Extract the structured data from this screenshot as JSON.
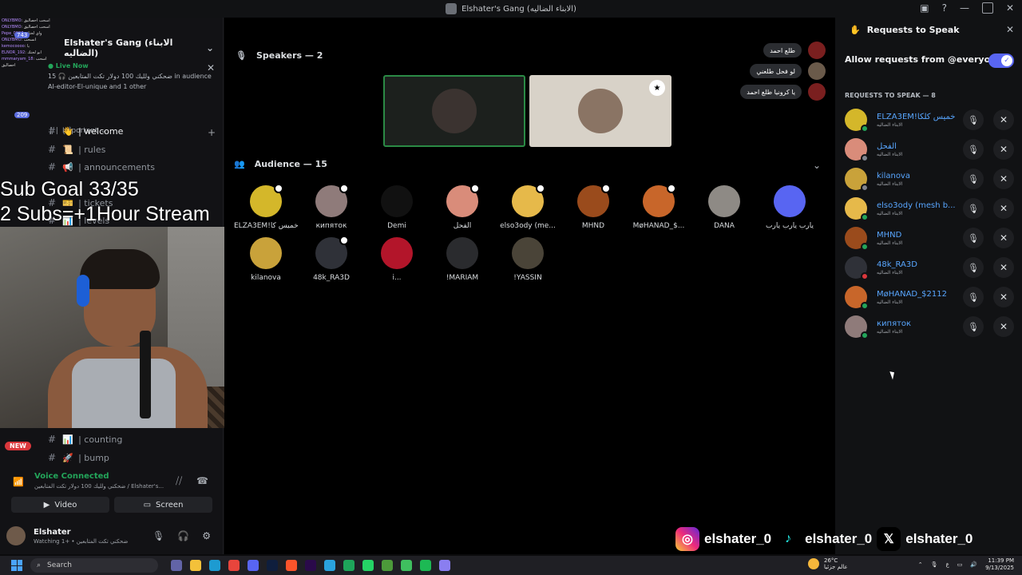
{
  "window": {
    "title": "Elshater's Gang (الابناء الضاليه)"
  },
  "sidebar": {
    "server_name": "Elshater's Gang (الابناء الضاليه)",
    "live": {
      "label": "Live Now",
      "line1": "ضحكني ولليك 100 دولار تكت المتابعين",
      "audience": "15 in audience",
      "line2": "AI-editor-El-unique and 1 other"
    },
    "overlay_chat": [
      {
        "nick": "ONLYBMO",
        "msg": "اسحب احصاليق"
      },
      {
        "nick": "ONLYBMO",
        "msg": "اسحب احصاليق"
      },
      {
        "nick": "Pepe_0997",
        "msg": "واي لحتك"
      },
      {
        "nick": "ONLYBMO",
        "msg": "انسحب"
      },
      {
        "nick": "kemocoooo",
        "msg": "يا"
      },
      {
        "nick": "ELNOR_192",
        "msg": "ابو لحتك"
      },
      {
        "nick": "mmmaryam_18",
        "msg": "اسحب احصاليق"
      }
    ],
    "badges": [
      "743",
      "209"
    ],
    "category": "Important",
    "channels": [
      {
        "emoji": "👋",
        "label": "| welcome",
        "active": true
      },
      {
        "emoji": "📜",
        "label": "| rules",
        "active": false
      },
      {
        "emoji": "📢",
        "label": "| announcements",
        "active": false
      },
      {
        "emoji": "🎫",
        "label": "| tickets",
        "active": false
      },
      {
        "emoji": "📊",
        "label": "| levels",
        "active": false
      }
    ],
    "bottom_channels": [
      {
        "emoji": "📊",
        "label": "| counting"
      },
      {
        "emoji": "🚀",
        "label": "| bump"
      }
    ],
    "new_label": "NEW",
    "voice": {
      "status": "Voice Connected",
      "detail": "ضحكني ولليك 100 دولار تكت المتابعين / Elshater's..."
    },
    "video_label": "Video",
    "screen_label": "Screen",
    "user": {
      "name": "Elshater",
      "status": "Watching ضحكني تكت المتابعين • +1"
    }
  },
  "overlay": {
    "goal_line1": "Sub Goal 33/35",
    "goal_line2": "2 Subs=+1Hour Stream"
  },
  "stage": {
    "speakers_label": "Speakers — 2",
    "audience_label": "Audience — 15",
    "chat": [
      {
        "text": "طلع احمد"
      },
      {
        "text": "لو فحل طلعني"
      },
      {
        "text": "يا كرونيا طلع احمد"
      }
    ],
    "audience": [
      {
        "name": "ELZA3EM!خميس كا",
        "color": "#d4b72a",
        "mod": true
      },
      {
        "name": "кипяток",
        "color": "#8f7b7a",
        "mod": true
      },
      {
        "name": "Demi",
        "color": "#111111",
        "mod": false
      },
      {
        "name": "الفحل",
        "color": "#d98c7a",
        "mod": true
      },
      {
        "name": "elso3ody (me...",
        "color": "#e6b94a",
        "mod": true
      },
      {
        "name": "MHND",
        "color": "#9a4b1c",
        "mod": true
      },
      {
        "name": "MøHANAD_$...",
        "color": "#c8662a",
        "mod": true
      },
      {
        "name": "DANA",
        "color": "#8e8a85",
        "mod": false
      },
      {
        "name": "يارب يارب يارب",
        "color": "#5865f2",
        "mod": false
      },
      {
        "name": "kilanova",
        "color": "#c9a23a",
        "mod": false
      },
      {
        "name": "48k_RA3D",
        "color": "#2f3138",
        "mod": true
      },
      {
        "name": "i...",
        "color": "#b3152a",
        "mod": false
      },
      {
        "name": "!MARIAM",
        "color": "#2a2b2e",
        "mod": false
      },
      {
        "name": "!YASSIN",
        "color": "#4a4438",
        "mod": false
      }
    ]
  },
  "requests": {
    "title": "Requests to Speak",
    "allow_label": "Allow requests from @everyone",
    "allow_enabled": true,
    "count_label": "REQUESTS TO SPEAK — 8",
    "items": [
      {
        "name": "ELZA3EM!خميس كلكا",
        "sub": "الابناء الضاليه",
        "color": "#d4b72a",
        "status": "#23a55a"
      },
      {
        "name": "الفحل",
        "sub": "الابناء الضاليه",
        "color": "#d98c7a",
        "status": "#80848e"
      },
      {
        "name": "kilanova",
        "sub": "الابناء الضاليه",
        "color": "#c9a23a",
        "status": "#80848e"
      },
      {
        "name": "elso3ody (mesh b...",
        "sub": "الابناء الضاليه",
        "color": "#e6b94a",
        "status": "#23a55a"
      },
      {
        "name": "MHND",
        "sub": "الابناء الضاليه",
        "color": "#9a4b1c",
        "status": "#23a55a"
      },
      {
        "name": "48k_RA3D",
        "sub": "الابناء الضاليه",
        "color": "#2f3138",
        "status": "#da373c"
      },
      {
        "name": "MøHANAD_$2112",
        "sub": "الابناء الضاليه",
        "color": "#c8662a",
        "status": "#23a55a"
      },
      {
        "name": "кипяток",
        "sub": "الابناء الضاليه",
        "color": "#8f7b7a",
        "status": "#23a55a"
      }
    ]
  },
  "socials": [
    {
      "platform": "instagram-icon",
      "handle": "elshater_0"
    },
    {
      "platform": "tiktok-icon",
      "handle": "elshater_0"
    },
    {
      "platform": "x-icon",
      "handle": "elshater_0"
    }
  ],
  "taskbar": {
    "search_placeholder": "Search",
    "weather_temp": "26°C",
    "weather_desc": "عالم جزئيا",
    "lang": "ع",
    "time": "11:39 PM",
    "date": "9/13/2025"
  }
}
